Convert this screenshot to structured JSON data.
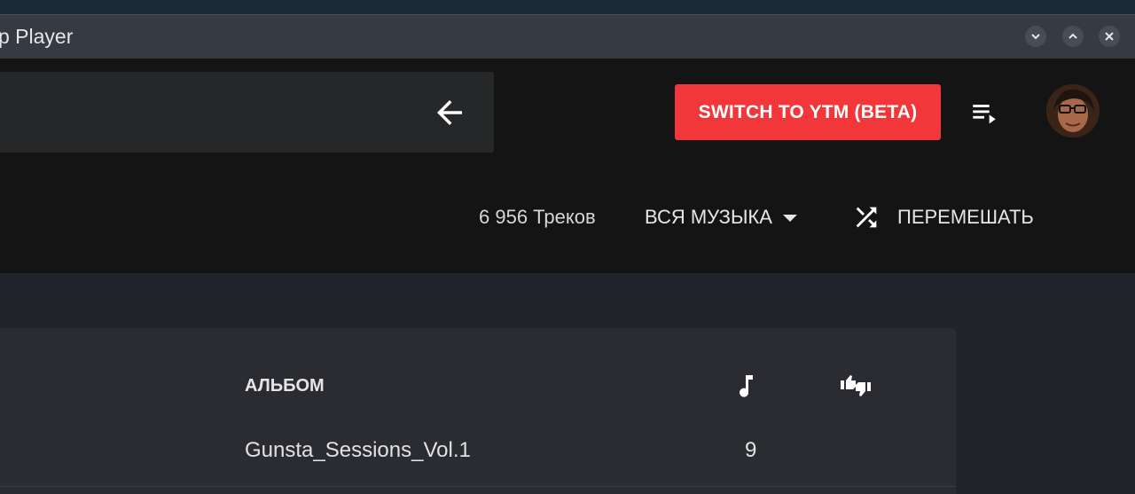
{
  "window": {
    "title": "p Player"
  },
  "header": {
    "switch_label": "SWITCH TO YTM (BETA)"
  },
  "toolbar": {
    "track_count": "6 956 Треков",
    "filter_label": "ВСЯ МУЗЫКА",
    "shuffle_label": "ПЕРЕМЕШАТЬ"
  },
  "table": {
    "headers": {
      "album": "АЛЬБОМ"
    },
    "rows": [
      {
        "album": "Gunsta_Sessions_Vol.1",
        "play_count": "9"
      }
    ]
  },
  "icons": {
    "back": "arrow-left-icon",
    "queue": "queue-music-icon",
    "shuffle": "shuffle-icon",
    "note": "music-note-icon",
    "rating": "thumbs-up-down-icon",
    "dropdown": "caret-down-icon"
  },
  "colors": {
    "accent": "#f2373a",
    "header_bg": "#141414",
    "page_bg": "#21242b",
    "card_bg": "#2a2c31"
  }
}
